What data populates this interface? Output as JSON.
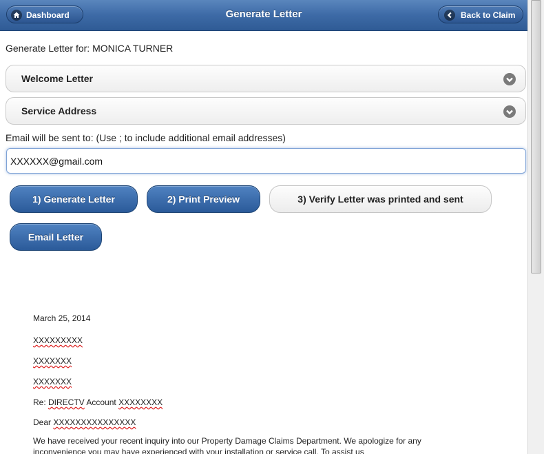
{
  "header": {
    "title": "Generate Letter",
    "dashboard_label": "Dashboard",
    "back_label": "Back to Claim"
  },
  "generate_for": "Generate Letter for: MONICA TURNER",
  "sections": [
    {
      "label": "Welcome Letter"
    },
    {
      "label": "Service Address"
    }
  ],
  "email": {
    "label": "Email will be sent to: (Use ; to include additional email addresses)",
    "value": "XXXXXX@gmail.com"
  },
  "actions": {
    "generate": "1) Generate Letter",
    "preview": "2) Print Preview",
    "verify": "3) Verify Letter was printed and sent",
    "email": "Email Letter"
  },
  "letter": {
    "date": "March 25, 2014",
    "line1": "XXXXXXXXX",
    "line2": "XXXXXXX",
    "line3": "XXXXXXX",
    "re_prefix": "Re: ",
    "re_company": "DIRECTV",
    "re_account": " Account ",
    "re_number": "XXXXXXXX",
    "dear_prefix": "Dear ",
    "dear_name": "XXXXXXXXXXXXXXX",
    "body": "We have received your recent inquiry into our Property Damage Claims Department. We apologize for any inconvenience you may have experienced with your installation or service call. To assist us"
  }
}
